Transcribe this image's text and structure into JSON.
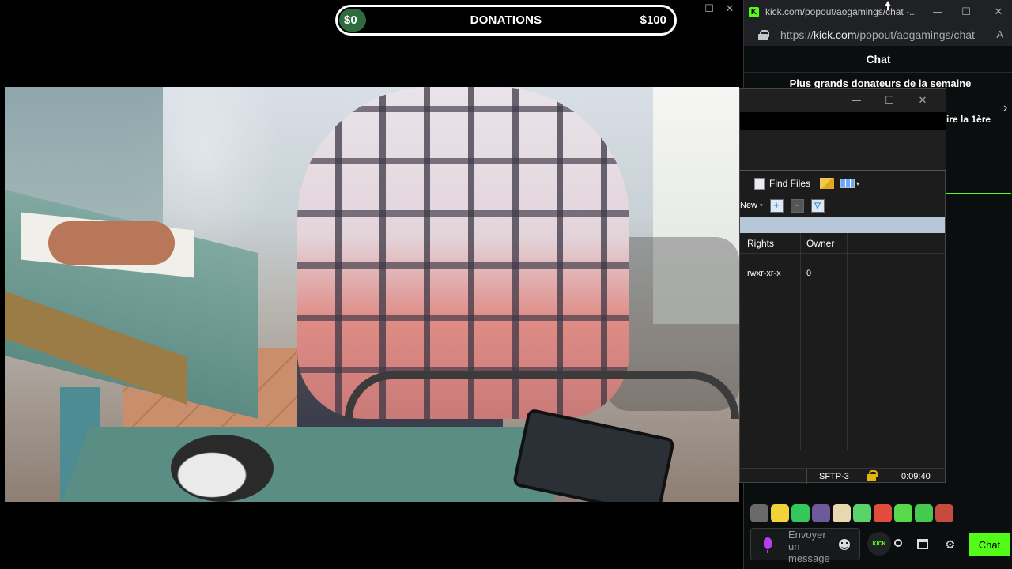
{
  "video_window": {
    "controls": {
      "minimize": "—",
      "maximize": "☐",
      "close": "✕"
    }
  },
  "donations": {
    "min_label": "$0",
    "title": "DONATIONS",
    "max_label": "$100",
    "progress_fraction": 0.08,
    "progress_color": "#2e6b3d"
  },
  "browser": {
    "tab_title": "kick.com/popout/aogamings/chat -...",
    "url_prefix": "https://",
    "url_domain": "kick.com",
    "url_path": "/popout/aogamings/chat",
    "reader_icon": "A",
    "controls": {
      "minimize": "—",
      "maximize": "☐",
      "close": "✕"
    },
    "accent_color": "#53fc18"
  },
  "chat": {
    "header": "Chat",
    "top_donors_title": "Plus grands donateurs de la semaine",
    "donor_partial_text": "ire la 1ère",
    "next_arrow": "›",
    "input_placeholder": "Envoyer un message",
    "kick_badge": "KICK",
    "settings_glyph": "⚙",
    "send_button": "Chat",
    "emotes": [
      "#6a6a6a",
      "#f2d13a",
      "#34c759",
      "#6e5a9a",
      "#e9d7b0",
      "#59d36a",
      "#e14d3a",
      "#57d94b",
      "#45c94f",
      "#c64a3d"
    ]
  },
  "sftp": {
    "controls": {
      "minimize": "—",
      "maximize": "☐",
      "close": "✕"
    },
    "toolbar": {
      "find_files": "Find Files",
      "view_dropdown": "▾",
      "new": "New",
      "new_dropdown": "▾",
      "add": "+",
      "remove": "−",
      "filter": "▽"
    },
    "columns": {
      "rights": "Rights",
      "owner": "Owner"
    },
    "file": {
      "rights": "rwxr-xr-x",
      "owner": "0"
    },
    "status": {
      "protocol": "SFTP-3",
      "time": "0:09:40"
    }
  }
}
